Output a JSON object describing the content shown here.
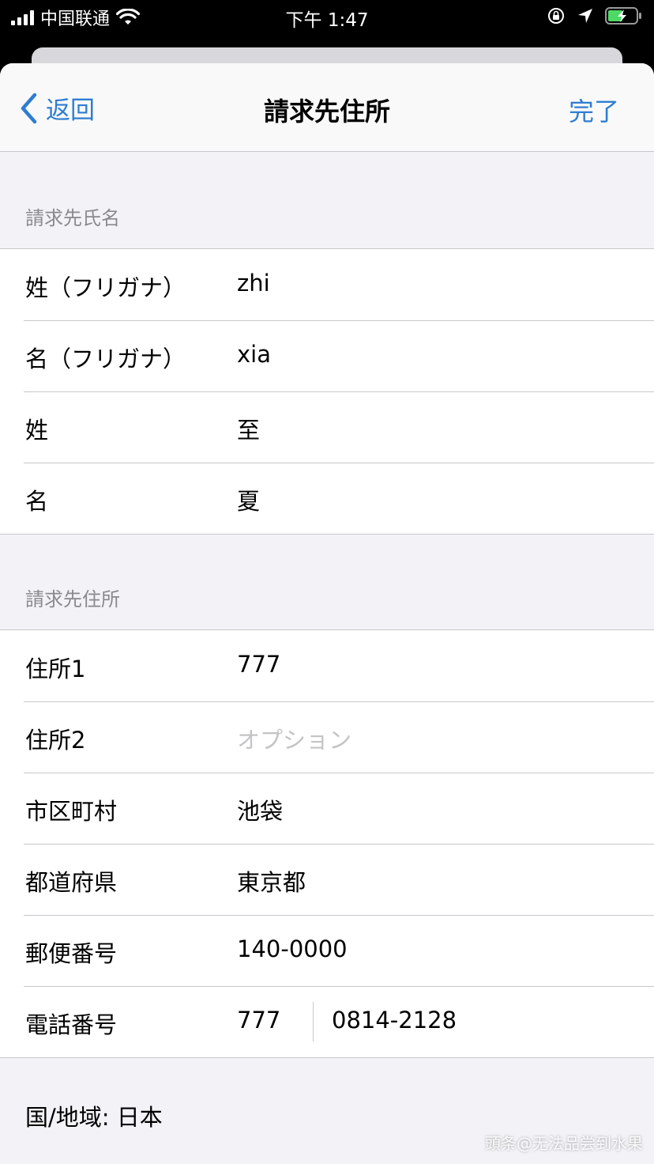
{
  "status_bar": {
    "carrier": "中国联通",
    "time": "下午 1:47"
  },
  "navbar": {
    "back_label": "返回",
    "title": "請求先住所",
    "done_label": "完了"
  },
  "name_section": {
    "header": "請求先氏名",
    "rows": [
      {
        "label": "姓（フリガナ）",
        "value": "zhi"
      },
      {
        "label": "名（フリガナ）",
        "value": "xia"
      },
      {
        "label": "姓",
        "value": "至"
      },
      {
        "label": "名",
        "value": "夏"
      }
    ]
  },
  "address_section": {
    "header": "請求先住所",
    "address1": {
      "label": "住所1",
      "value": "777"
    },
    "address2": {
      "label": "住所2",
      "placeholder": "オプション"
    },
    "city": {
      "label": "市区町村",
      "value": "池袋"
    },
    "prefecture": {
      "label": "都道府県",
      "value": "東京都"
    },
    "postal": {
      "label": "郵便番号",
      "value": "140-0000"
    },
    "phone": {
      "label": "電話番号",
      "area_code": "777",
      "number": "0814-2128"
    }
  },
  "footer": {
    "region": "国/地域: 日本"
  },
  "watermark": "頭条@无法品尝到水果",
  "colors": {
    "accent": "#2f7dd1",
    "background": "#f2f2f7",
    "separator": "#c8c7cc",
    "secondary_text": "#8a8a8e"
  }
}
